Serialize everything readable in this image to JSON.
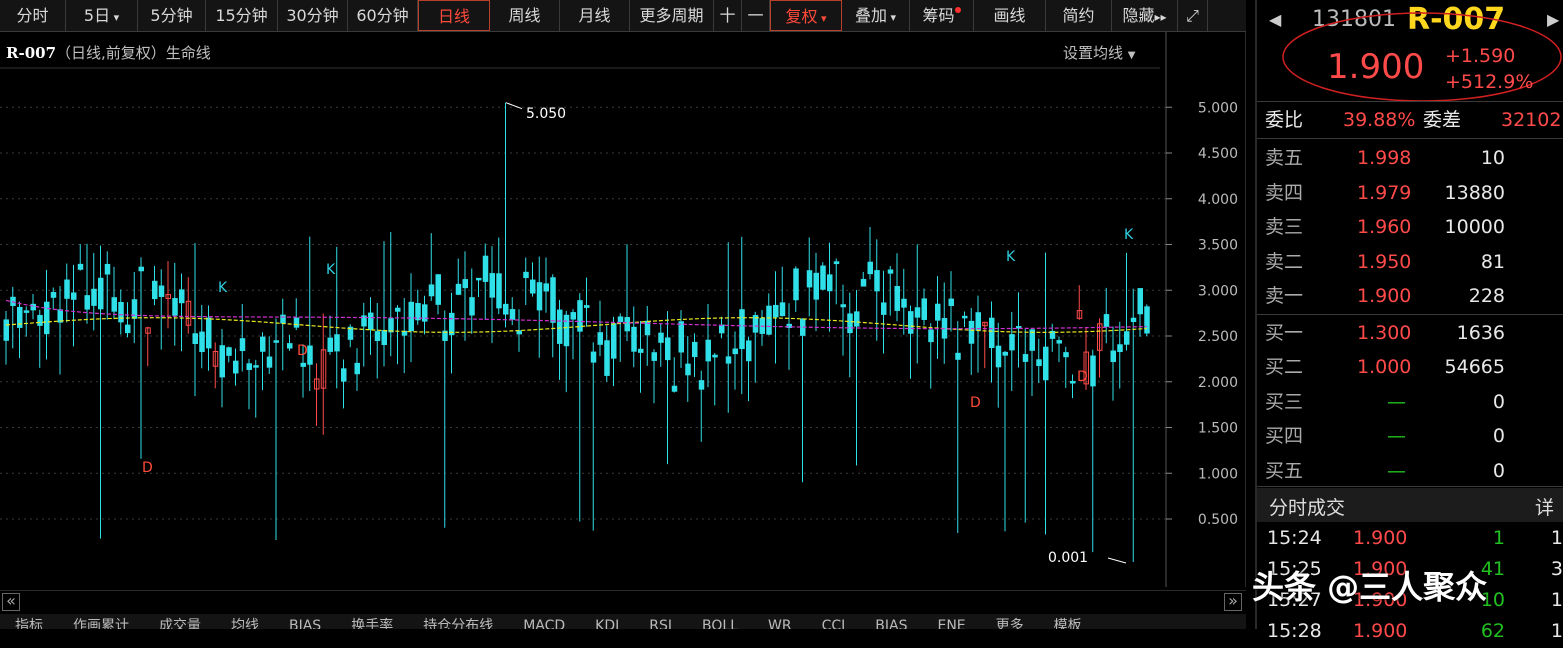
{
  "toolbar": {
    "items": [
      "分时",
      "5日",
      "5分钟",
      "15分钟",
      "30分钟",
      "60分钟",
      "日线",
      "周线",
      "月线",
      "更多周期",
      "十",
      "一",
      "复权",
      "叠加",
      "筹码",
      "画线",
      "简约",
      "隐藏"
    ],
    "active": "日线"
  },
  "chart": {
    "title_name": "R-007",
    "title_rest": "（日线,前复权）生命线",
    "ma_setting_label": "设置均线",
    "y_axis_labels": [
      "5.000",
      "4.500",
      "4.000",
      "3.500",
      "3.000",
      "2.500",
      "2.000",
      "1.500",
      "1.000",
      "0.500"
    ],
    "max_label": "5.050",
    "min_label": "0.001",
    "markers": [
      {
        "text": "K",
        "color": "#30d0e0"
      },
      {
        "text": "D",
        "color": "#ff4a3a"
      }
    ]
  },
  "bottom_tabs": [
    "指标",
    "作画累计",
    "成交量",
    "均线",
    "BIAS",
    "换手率",
    "持仓分布线",
    "MACD",
    "KDJ",
    "RSI",
    "BOLL",
    "WR",
    "CCI",
    "BIAS",
    "ENE",
    "更多",
    "模板"
  ],
  "quote": {
    "code": "131801",
    "name": "R-007",
    "price": "1.900",
    "change": "+1.590",
    "change_pct": "+512.9%",
    "wei_bi_label": "委比",
    "wei_bi": "39.88%",
    "wei_cha_label": "委差",
    "wei_cha": "32102",
    "asks": [
      {
        "label": "卖五",
        "price": "1.998",
        "vol": "10"
      },
      {
        "label": "卖四",
        "price": "1.979",
        "vol": "13880"
      },
      {
        "label": "卖三",
        "price": "1.960",
        "vol": "10000"
      },
      {
        "label": "卖二",
        "price": "1.950",
        "vol": "81"
      },
      {
        "label": "卖一",
        "price": "1.900",
        "vol": "228"
      }
    ],
    "bids": [
      {
        "label": "买一",
        "price": "1.300",
        "vol": "1636"
      },
      {
        "label": "买二",
        "price": "1.000",
        "vol": "54665"
      },
      {
        "label": "买三",
        "price": "—",
        "vol": "0"
      },
      {
        "label": "买四",
        "price": "—",
        "vol": "0"
      },
      {
        "label": "买五",
        "price": "—",
        "vol": "0"
      }
    ],
    "trades_title": "分时成交",
    "trades_detail": "详",
    "trades": [
      {
        "time": "15:24",
        "price": "1.900",
        "vol": "1",
        "n": "1"
      },
      {
        "time": "15:25",
        "price": "1.900",
        "vol": "41",
        "n": "3"
      },
      {
        "time": "15:27",
        "price": "1.900",
        "vol": "10",
        "n": "1"
      },
      {
        "time": "15:28",
        "price": "1.900",
        "vol": "62",
        "n": "1"
      }
    ]
  },
  "watermark": "头条 @三人聚众"
}
